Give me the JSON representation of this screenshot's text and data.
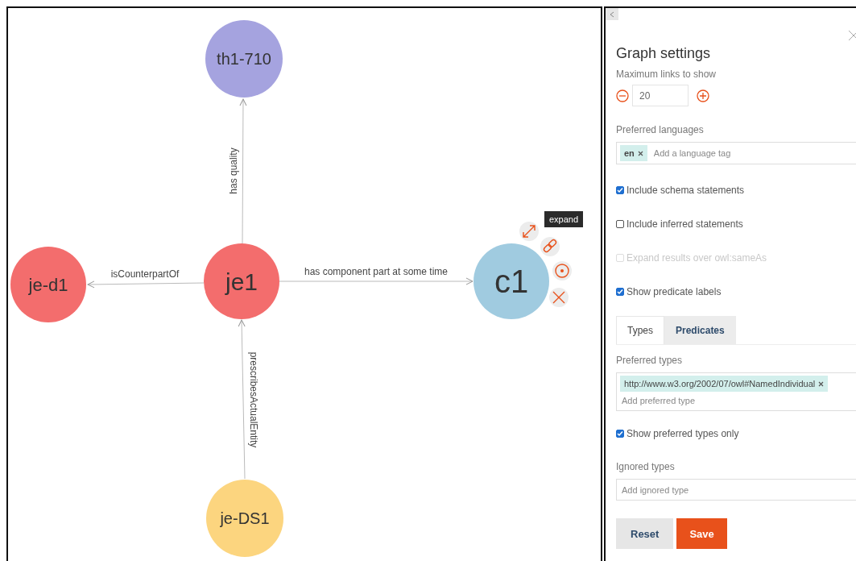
{
  "graph": {
    "nodes": [
      {
        "label": "th1-710",
        "color": "#a5a3df"
      },
      {
        "label": "je-d1",
        "color": "#f36d6d"
      },
      {
        "label": "je1",
        "color": "#f36d6d"
      },
      {
        "label": "c1",
        "color": "#a0cbe0"
      },
      {
        "label": "je-DS1",
        "color": "#fcd57f"
      }
    ],
    "edges": [
      {
        "label": "has quality"
      },
      {
        "label": "isCounterpartOf"
      },
      {
        "label": "has component part at some time"
      },
      {
        "label": "prescribesActualEntity"
      }
    ],
    "tooltip": "expand"
  },
  "settings": {
    "title": "Graph settings",
    "max_links": {
      "label": "Maximum links to show",
      "value": "20"
    },
    "languages": {
      "label": "Preferred languages",
      "tags": [
        "en"
      ],
      "placeholder": "Add a language tag"
    },
    "options": [
      {
        "label": "Include schema statements",
        "checked": true,
        "disabled": false
      },
      {
        "label": "Include inferred statements",
        "checked": false,
        "disabled": false
      },
      {
        "label": "Expand results over owl:sameAs",
        "checked": false,
        "disabled": true
      },
      {
        "label": "Show predicate labels",
        "checked": true,
        "disabled": false
      }
    ],
    "tabs": [
      {
        "label": "Types",
        "selected": true
      },
      {
        "label": "Predicates",
        "selected": false
      }
    ],
    "preferred_types": {
      "label": "Preferred types",
      "tags": [
        "http://www.w3.org/2002/07/owl#NamedIndividual"
      ],
      "placeholder": "Add preferred type"
    },
    "preferred_only": {
      "label": "Show preferred types only",
      "checked": true
    },
    "ignored_types": {
      "label": "Ignored types",
      "placeholder": "Add ignored type"
    },
    "buttons": {
      "reset": "Reset",
      "save": "Save"
    }
  }
}
